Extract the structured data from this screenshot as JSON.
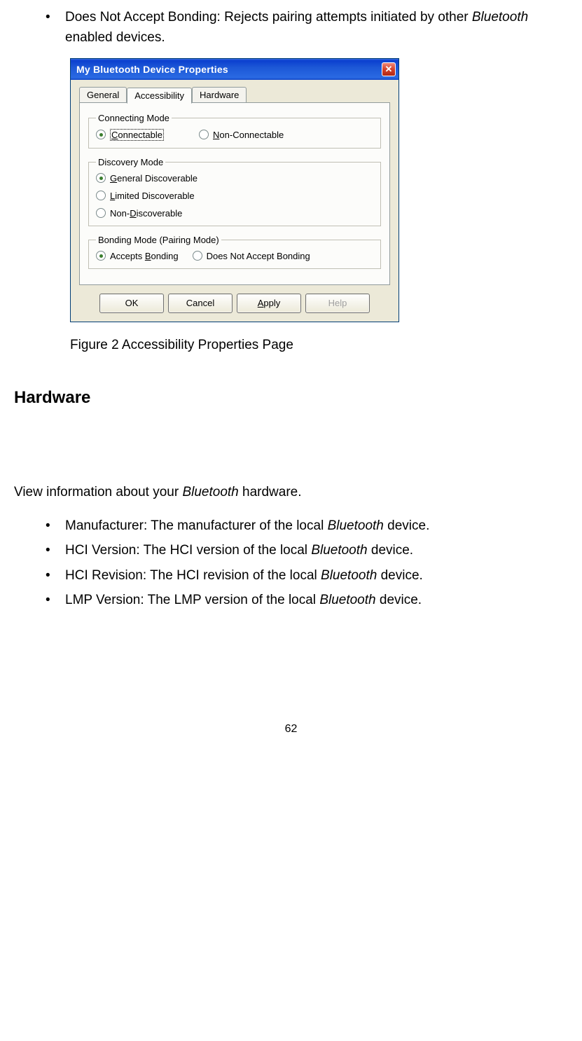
{
  "topBullet": {
    "prefix": "Does Not Accept Bonding: Rejects pairing attempts initiated by other ",
    "italic": "Bluetooth",
    "suffix": " enabled devices."
  },
  "dialog": {
    "title": "My Bluetooth Device Properties",
    "tabs": [
      "General",
      "Accessibility",
      "Hardware"
    ],
    "connectingMode": {
      "legend": "Connecting Mode",
      "connectable": "Connectable",
      "nonConnectable": "Non-Connectable"
    },
    "discoveryMode": {
      "legend": "Discovery Mode",
      "general": "General Discoverable",
      "limited": "Limited Discoverable",
      "nonDisc": "Non-Discoverable"
    },
    "bondingMode": {
      "legend": "Bonding Mode (Pairing Mode)",
      "accepts": "Accepts Bonding",
      "rejects": "Does Not Accept Bonding"
    },
    "buttons": {
      "ok": "OK",
      "cancel": "Cancel",
      "apply": "Apply",
      "help": "Help"
    }
  },
  "figureCaption": "Figure 2 Accessibility Properties Page",
  "hardwareHeading": "Hardware",
  "hardwareIntro": {
    "prefix": "View information about your ",
    "italic": "Bluetooth",
    "suffix": " hardware."
  },
  "hwBullets": [
    {
      "label": "Manufacturer:   The manufacturer of the local ",
      "italic": "Bluetooth",
      "suffix": " device."
    },
    {
      "label": "HCI Version: The HCI version of the local ",
      "italic": "Bluetooth",
      "suffix": " device."
    },
    {
      "label": "HCI Revision: The HCI revision of the local ",
      "italic": "Bluetooth",
      "suffix": " device."
    },
    {
      "label": "LMP Version: The LMP version of the local ",
      "italic": "Bluetooth",
      "suffix": " device."
    }
  ],
  "pageNumber": "62"
}
